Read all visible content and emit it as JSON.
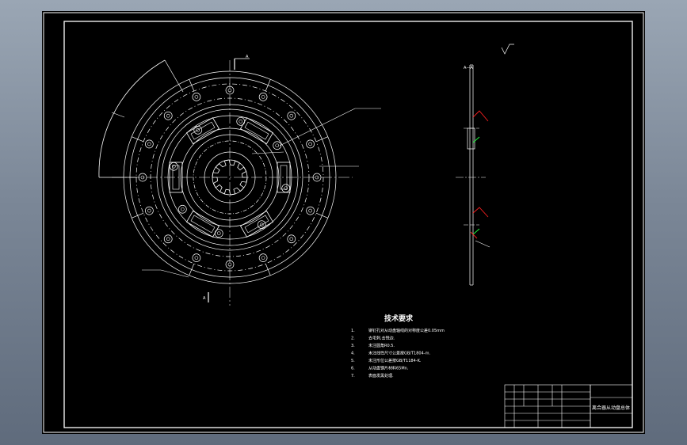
{
  "drawing": {
    "colors": {
      "background": "#000000",
      "linework": "#ffffff",
      "dim_red": "#ff2020",
      "dim_green": "#20ff40"
    },
    "section_view": {
      "section_marker_label": "A",
      "section_title": "A—A"
    },
    "technical_requirements": {
      "title": "技术要求",
      "items": [
        {
          "num": "1.",
          "text": "铆钉孔对从动盘轴线的对称度公差0.05mm"
        },
        {
          "num": "2.",
          "text": "去毛刺,去锐边."
        },
        {
          "num": "3.",
          "text": "未注圆角R0.5."
        },
        {
          "num": "4.",
          "text": "未注线性尺寸公差按GB/T1804-m."
        },
        {
          "num": "5.",
          "text": "未注形位公差按GB/T1184-K."
        },
        {
          "num": "6.",
          "text": "从动盘钢片材料65Mn."
        },
        {
          "num": "7.",
          "text": "表面发黑处理."
        }
      ]
    },
    "title_block": {
      "part_name": "离合器从动盘总体"
    }
  }
}
